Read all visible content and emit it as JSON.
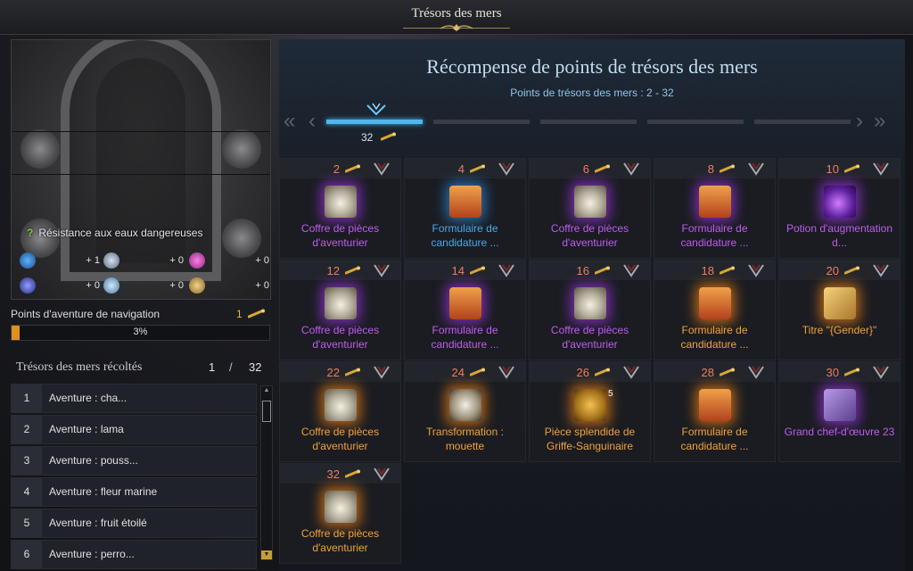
{
  "window": {
    "title": "Trésors des mers"
  },
  "left": {
    "resistance_label": "Résistance aux eaux dangereuses",
    "stats": [
      {
        "icon": "wave-icon",
        "value": "+ 1"
      },
      {
        "icon": "wind-icon",
        "value": "+ 0"
      },
      {
        "icon": "fish-icon",
        "value": "+ 0"
      },
      {
        "icon": "storm-icon",
        "value": "+ 0"
      },
      {
        "icon": "ice-icon",
        "value": "+ 0"
      },
      {
        "icon": "whirlpool-icon",
        "value": "+ 0"
      }
    ],
    "nav_label": "Points d'aventure de navigation",
    "nav_count": "1",
    "progress_text": "3%",
    "progress_value": 0.03,
    "harvest_title": "Trésors des mers récoltés",
    "harvest_current": "1",
    "harvest_sep": "/",
    "harvest_total": "32",
    "list": [
      {
        "num": "1",
        "label": "Aventure : cha..."
      },
      {
        "num": "2",
        "label": "Aventure : lama"
      },
      {
        "num": "3",
        "label": "Aventure : pouss..."
      },
      {
        "num": "4",
        "label": "Aventure : fleur marine"
      },
      {
        "num": "5",
        "label": "Aventure : fruit étoilé"
      },
      {
        "num": "6",
        "label": "Aventure : perro..."
      }
    ]
  },
  "right": {
    "heading": "Récompense de points de trésors des mers",
    "subheading": "Points de trésors des mers : 2 - 32",
    "tier_value": "32",
    "colors": {
      "purple": "#c05cf0",
      "blue": "#4aa9ea",
      "orange": "#f0a23c"
    },
    "rewards": [
      {
        "pts": "2",
        "name": "Coffre de pièces d'aventurier",
        "rarity": "purple",
        "icon": "chest-icon"
      },
      {
        "pts": "4",
        "name": "Formulaire de candidature ...",
        "rarity": "blue",
        "icon": "scroll-icon"
      },
      {
        "pts": "6",
        "name": "Coffre de pièces d'aventurier",
        "rarity": "purple",
        "icon": "chest-icon"
      },
      {
        "pts": "8",
        "name": "Formulaire de candidature ...",
        "rarity": "purple",
        "icon": "scroll-icon"
      },
      {
        "pts": "10",
        "name": "Potion d'augmentation d...",
        "rarity": "purple",
        "icon": "potion-icon"
      },
      {
        "pts": "12",
        "name": "Coffre de pièces d'aventurier",
        "rarity": "purple",
        "icon": "chest-icon"
      },
      {
        "pts": "14",
        "name": "Formulaire de candidature ...",
        "rarity": "purple",
        "icon": "scroll-icon"
      },
      {
        "pts": "16",
        "name": "Coffre de pièces d'aventurier",
        "rarity": "purple",
        "icon": "chest-icon"
      },
      {
        "pts": "18",
        "name": "Formulaire de candidature ...",
        "rarity": "orange",
        "icon": "scroll-icon"
      },
      {
        "pts": "20",
        "name": "Titre \"{Gender}\"",
        "rarity": "orange",
        "icon": "title-scroll-icon"
      },
      {
        "pts": "22",
        "name": "Coffre de pièces d'aventurier",
        "rarity": "orange",
        "icon": "chest-icon"
      },
      {
        "pts": "24",
        "name": "Transformation : mouette",
        "rarity": "orange",
        "icon": "seagull-icon"
      },
      {
        "pts": "26",
        "name": "Pièce splendide de Griffe-Sanguinaire",
        "rarity": "orange",
        "icon": "coin-icon",
        "qty": "5"
      },
      {
        "pts": "28",
        "name": "Formulaire de candidature ...",
        "rarity": "orange",
        "icon": "scroll-icon"
      },
      {
        "pts": "30",
        "name": "Grand chef-d'œuvre 23",
        "rarity": "purple",
        "icon": "map-icon"
      },
      {
        "pts": "32",
        "name": "Coffre de pièces d'aventurier",
        "rarity": "orange",
        "icon": "chest-icon"
      }
    ]
  }
}
